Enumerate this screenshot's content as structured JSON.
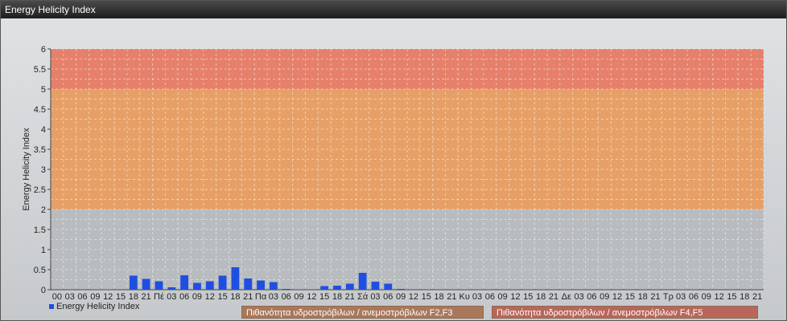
{
  "window": {
    "title": "Energy Helicity Index"
  },
  "legend": {
    "series": "Energy Helicity Index",
    "band1": "Πιθανότητα υδροστρόβιλων / ανεμοστρόβιλων F2,F3",
    "band2": "Πιθανότητα υδροστρόβιλων / ανεμοστρόβιλων F4,F5"
  },
  "colors": {
    "bar": "#1f4fe0",
    "band_low": "#e6a067",
    "band_high": "#e6806a",
    "band1_legend": "#a9785a",
    "band2_legend": "#b9665a"
  },
  "chart_data": {
    "type": "bar",
    "title": "",
    "xlabel": "",
    "ylabel": "Energy Helicity Index",
    "ylim": [
      0,
      6
    ],
    "yticks": [
      "0",
      "0.5",
      "1",
      "1.5",
      "2",
      "2.5",
      "3",
      "3.5",
      "4",
      "4.5",
      "5",
      "5.5",
      "6"
    ],
    "bands": [
      {
        "from": 2,
        "to": 5,
        "label": "Πιθανότητα υδροστρόβιλων / ανεμοστρόβιλων F2,F3"
      },
      {
        "from": 5,
        "to": 6,
        "label": "Πιθανότητα υδροστρόβιλων / ανεμοστρόβιλων F4,F5"
      }
    ],
    "categories": [
      "00",
      "03",
      "06",
      "09",
      "12",
      "15",
      "18",
      "21",
      "Πέ",
      "03",
      "06",
      "09",
      "12",
      "15",
      "18",
      "21",
      "Πα",
      "03",
      "06",
      "09",
      "12",
      "15",
      "18",
      "21",
      "Σά",
      "03",
      "06",
      "09",
      "12",
      "15",
      "18",
      "21",
      "Κυ",
      "03",
      "06",
      "09",
      "12",
      "15",
      "18",
      "21",
      "Δε",
      "03",
      "06",
      "09",
      "12",
      "15",
      "18",
      "21",
      "Τρ",
      "03",
      "06",
      "09",
      "12",
      "15",
      "18",
      "21"
    ],
    "series": [
      {
        "name": "Energy Helicity Index",
        "values": [
          0.01,
          0.01,
          0.01,
          0.01,
          0.01,
          0.01,
          0.35,
          0.27,
          0.21,
          0.06,
          0.36,
          0.17,
          0.21,
          0.35,
          0.56,
          0.28,
          0.23,
          0.19,
          0.02,
          0.01,
          0.01,
          0.09,
          0.1,
          0.15,
          0.42,
          0.2,
          0.15,
          0.02,
          0.01,
          0.01,
          0.01,
          0.01,
          0.01,
          0.01,
          0.01,
          0.01,
          0.01,
          0.01,
          0.01,
          0.01,
          0.01,
          0.01,
          0.01,
          0.01,
          0.01,
          0.01,
          0.01,
          0.01,
          0.01,
          0.01,
          0.01,
          0.01,
          0.01,
          0.01,
          0.01,
          0.01
        ]
      }
    ]
  }
}
